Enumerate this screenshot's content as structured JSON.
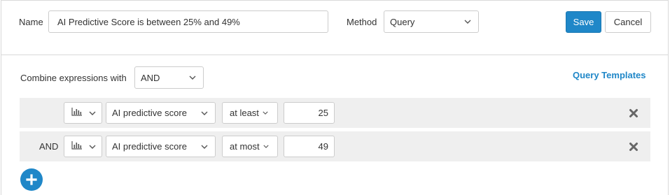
{
  "form": {
    "name_label": "Name",
    "name_value": "AI Predictive Score is between 25% and 49%",
    "method_label": "Method",
    "method_value": "Query",
    "save_label": "Save",
    "cancel_label": "Cancel"
  },
  "query": {
    "combine_label": "Combine expressions with",
    "combine_value": "AND",
    "templates_link": "Query Templates",
    "rows": [
      {
        "join": "",
        "chart_icon": "bar-chart-icon",
        "field": "AI predictive score",
        "operator": "at least",
        "value": "25"
      },
      {
        "join": "AND",
        "chart_icon": "bar-chart-icon",
        "field": "AI predictive score",
        "operator": "at most",
        "value": "49"
      }
    ]
  },
  "colors": {
    "accent": "#1f87c8",
    "row_bg": "#efefef",
    "remove_icon": "#666666"
  },
  "icons": {
    "remove": "close-icon",
    "add": "plus-circle-icon",
    "dropdown": "chevron-down-icon"
  }
}
